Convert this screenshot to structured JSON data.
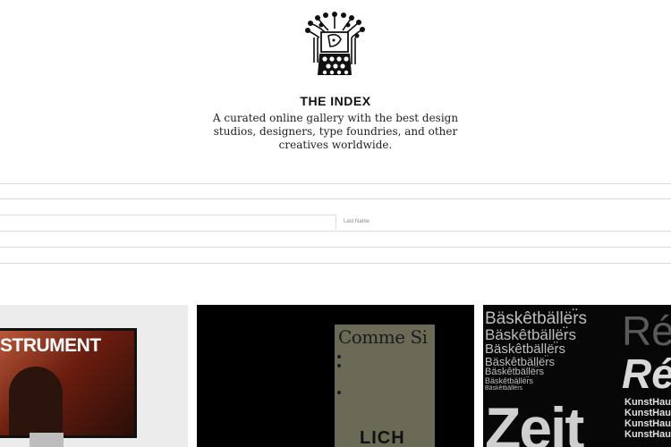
{
  "header": {
    "title": "THE INDEX",
    "tagline": "A curated online gallery with the best design studios, designers, type foundries, and other creatives worldwide."
  },
  "form": {
    "last_name_placeholder": "Last Name"
  },
  "gallery": {
    "card1": {
      "headline": "STRUMENT"
    },
    "card2": {
      "book_title": "Comme Si",
      "book_bottom": "LICH"
    },
    "card3": {
      "specimen_word": "Bäskêtbällër̈s",
      "re_text": "Ré",
      "kunst_text": "KunstHaus",
      "zeit_text": "Zeit"
    }
  }
}
